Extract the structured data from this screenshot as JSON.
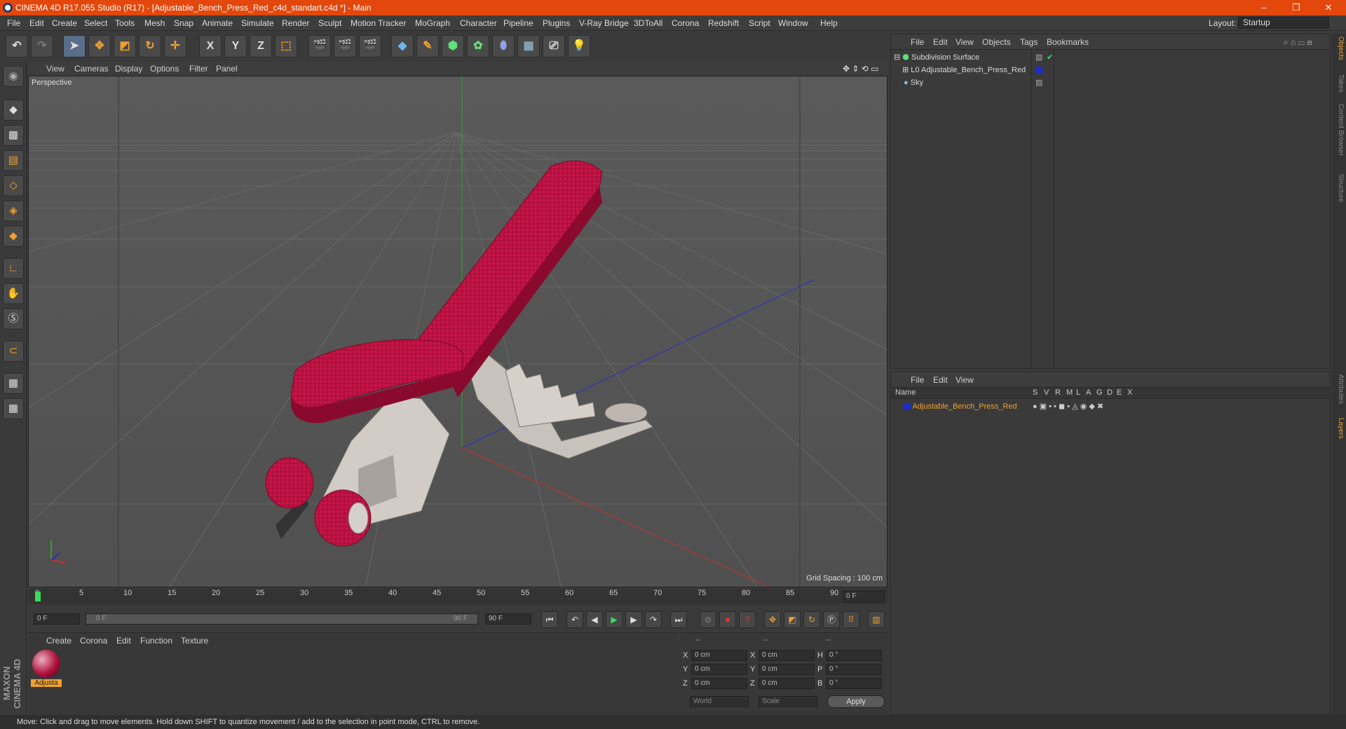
{
  "window": {
    "title": "CINEMA 4D R17.055 Studio (R17) - [Adjustable_Bench_Press_Red_c4d_standart.c4d *] - Main",
    "minimize": "–",
    "restore": "❐",
    "close": "✕",
    "layout_label": "Layout:",
    "layout_value": "Startup"
  },
  "menubar": [
    "File",
    "Edit",
    "Create",
    "Select",
    "Tools",
    "Mesh",
    "Snap",
    "Animate",
    "Simulate",
    "Render",
    "Sculpt",
    "Motion Tracker",
    "MoGraph",
    "Character",
    "Pipeline",
    "Plugins",
    "V-Ray Bridge",
    "3DToAll",
    "Corona",
    "Redshift",
    "Script",
    "Window",
    "Help"
  ],
  "toolbar": {
    "undo": "↶",
    "redo": "↷",
    "x_axis": "X",
    "y_axis": "Y",
    "z_axis": "Z"
  },
  "viewport": {
    "menu": [
      "View",
      "Cameras",
      "Display",
      "Options",
      "Filter",
      "Panel"
    ],
    "label": "Perspective",
    "grid_spacing": "Grid Spacing : 100 cm"
  },
  "timeline": {
    "ticks": [
      "0",
      "5",
      "10",
      "15",
      "20",
      "25",
      "30",
      "35",
      "40",
      "45",
      "50",
      "55",
      "60",
      "65",
      "70",
      "75",
      "80",
      "85",
      "90"
    ],
    "current_frame": "0 F",
    "start_field": "0 F",
    "range_start": "0 F",
    "range_end": "90 F",
    "end_field": "90 F"
  },
  "material_panel": {
    "menu": [
      "Create",
      "Corona",
      "Edit",
      "Function",
      "Texture"
    ],
    "material_name": "Adjusta"
  },
  "coords": {
    "headers": [
      "--",
      "--",
      "--"
    ],
    "rows": [
      {
        "a": "X",
        "av": "0 cm",
        "b": "X",
        "bv": "0 cm",
        "c": "H",
        "cv": "0 °"
      },
      {
        "a": "Y",
        "av": "0 cm",
        "b": "Y",
        "bv": "0 cm",
        "c": "P",
        "cv": "0 °"
      },
      {
        "a": "Z",
        "av": "0 cm",
        "b": "Z",
        "bv": "0 cm",
        "c": "B",
        "cv": "0 °"
      }
    ],
    "world": "World",
    "scale": "Scale",
    "apply": "Apply"
  },
  "object_manager": {
    "menu": [
      "File",
      "Edit",
      "View",
      "Objects",
      "Tags",
      "Bookmarks"
    ],
    "objects": [
      {
        "name": "Subdivision Surface"
      },
      {
        "name": "Adjustable_Bench_Press_Red"
      },
      {
        "name": "Sky"
      }
    ]
  },
  "layer_manager": {
    "menu": [
      "File",
      "Edit",
      "View"
    ],
    "col_name": "Name",
    "cols": [
      "S",
      "V",
      "R",
      "M",
      "L",
      "A",
      "G",
      "D",
      "E",
      "X"
    ],
    "layers": [
      {
        "name": "Adjustable_Bench_Press_Red"
      }
    ]
  },
  "right_tabs": [
    "Objects",
    "Takes",
    "Content Browser",
    "Structure",
    "Attributes",
    "Layers"
  ],
  "brand": "MAXON CINEMA 4D",
  "status": "Move: Click and drag to move elements. Hold down SHIFT to quantize movement / add to the selection in point mode, CTRL to remove.",
  "colors": {
    "accent": "#e3470c",
    "bench": "#b0103c",
    "frame": "#c8c2bc"
  }
}
